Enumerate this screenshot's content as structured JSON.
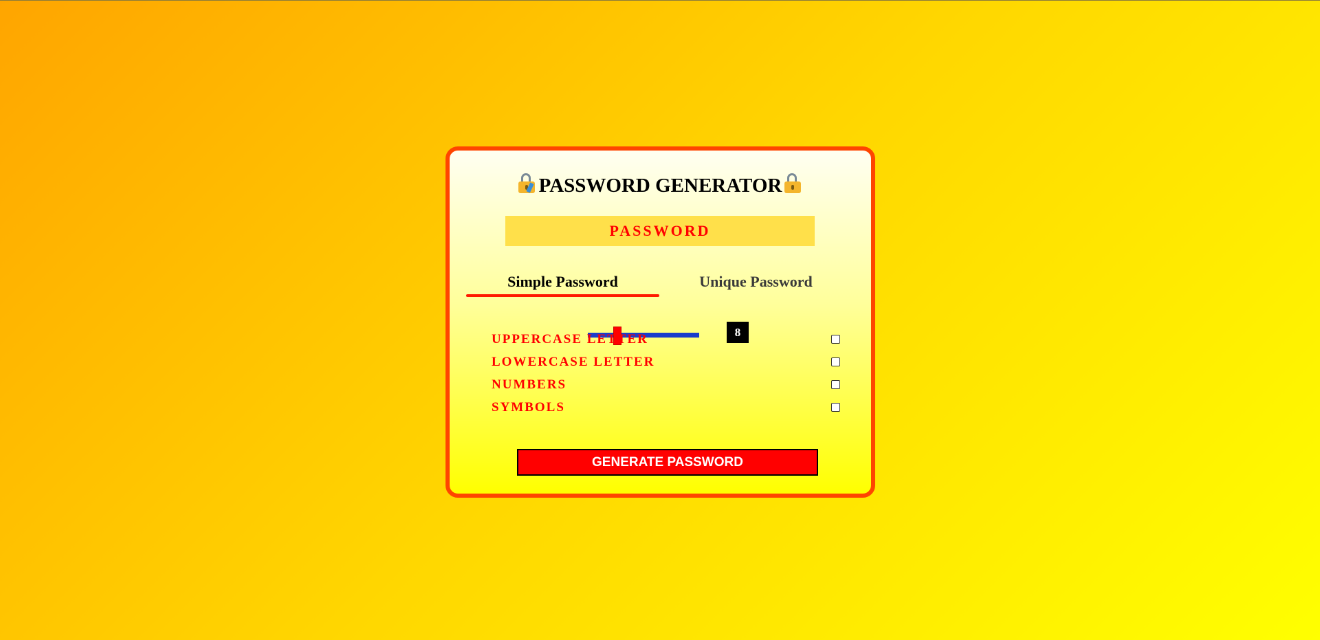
{
  "header": {
    "title": "PASSWORD GENERATOR",
    "left_icon": "lock-with-pen-icon",
    "right_icon": "lock-icon"
  },
  "display": {
    "password_text": "PASSWORD"
  },
  "tabs": [
    {
      "label": "Simple Password",
      "active": true
    },
    {
      "label": "Unique Password",
      "active": false
    }
  ],
  "length": {
    "value": "8"
  },
  "options": [
    {
      "label": "UPPERCASE LETTER",
      "checked": false
    },
    {
      "label": "LOWERCASE LETTER",
      "checked": false
    },
    {
      "label": "NUMBERS",
      "checked": false
    },
    {
      "label": "SYMBOLS",
      "checked": false
    }
  ],
  "actions": {
    "generate_label": "GENERATE PASSWORD"
  },
  "colors": {
    "accent": "#ff0000",
    "card_border": "#ff4500",
    "slider_track": "#1a3ccc",
    "background_start": "#ffa500",
    "background_end": "#ffff00"
  }
}
